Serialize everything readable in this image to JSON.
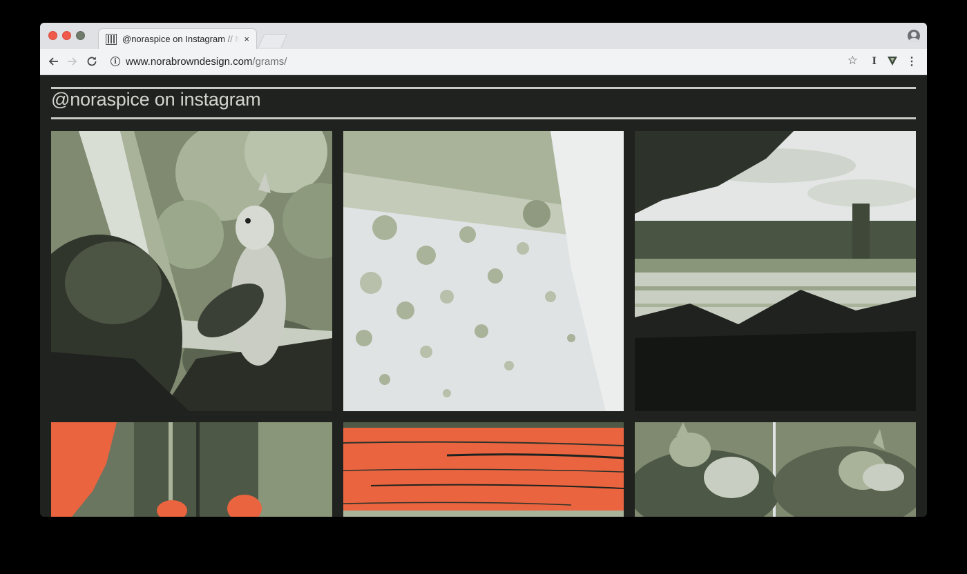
{
  "browser": {
    "tab_title": "@noraspice on Instagram // Nora Brown Design",
    "tab_close": "×",
    "url_host": "www.norabrowndesign.com",
    "url_path": "/grams/",
    "icons": [
      "back-arrow-icon",
      "forward-arrow-icon",
      "reload-icon",
      "info-icon",
      "star-icon",
      "extension-i-icon",
      "extension-v-icon",
      "menu-icon",
      "profile-icon"
    ]
  },
  "page": {
    "title": "@noraspice on instagram"
  },
  "gallery": {
    "photos": [
      {
        "subject": "cat-and-squirrel"
      },
      {
        "subject": "textured-clouds"
      },
      {
        "subject": "marsh-landscape"
      },
      {
        "subject": "orange-flowers"
      },
      {
        "subject": "orange-wood"
      },
      {
        "subject": "sleeping-cat-diptych"
      }
    ]
  },
  "colors": {
    "background": "#1f221e",
    "accent_orange": "#ea6440",
    "sage": "#a9b39a",
    "pale": "#dfe3e3",
    "title_text": "#d3d6cf"
  }
}
